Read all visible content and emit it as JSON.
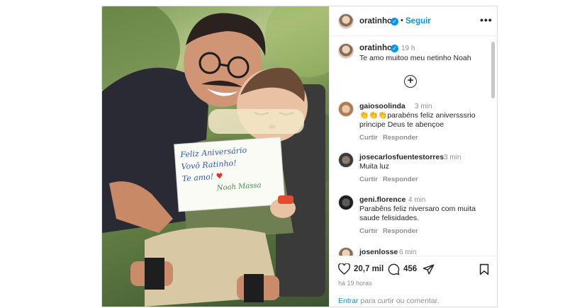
{
  "post": {
    "author": "oratinho",
    "follow_label": "Seguir",
    "more_label": "•••",
    "dot": "•",
    "caption_author": "oratinho",
    "caption_time": "19 h",
    "caption_text": "Te amo muitoo meu netinho Noah"
  },
  "photo": {
    "sign_lines": [
      "Feliz Aniversário",
      "Vovô Ratinho!",
      "Te amo!",
      "Noah Massa"
    ]
  },
  "comments": [
    {
      "user": "gaiosoolinda",
      "time": "3 min",
      "text_line1": "👏👏👏parabéns feliz aniversssrio",
      "text_line2": "principe Deus te abençoe",
      "like": "Curtir",
      "reply": "Responder"
    },
    {
      "user": "josecarlosfuentestorres",
      "time": "3 min",
      "text_line1": "Muita luz",
      "like": "Curtir",
      "reply": "Responder"
    },
    {
      "user": "geni.florence",
      "time": "4 min",
      "text_line1": "Parabêns feliz niversaro com muita",
      "text_line2": "saude felisidades.",
      "like": "Curtir",
      "reply": "Responder"
    },
    {
      "user": "josenlosse",
      "time": "6 min"
    }
  ],
  "footer": {
    "likes": "20,7 mil",
    "comments_count": "456",
    "time": "há 19 horas",
    "login_link": "Entrar",
    "login_rest": "para curtir ou comentar."
  },
  "colors": {
    "accent": "#0095f6",
    "text": "#262626",
    "muted": "#8e8e8e"
  }
}
